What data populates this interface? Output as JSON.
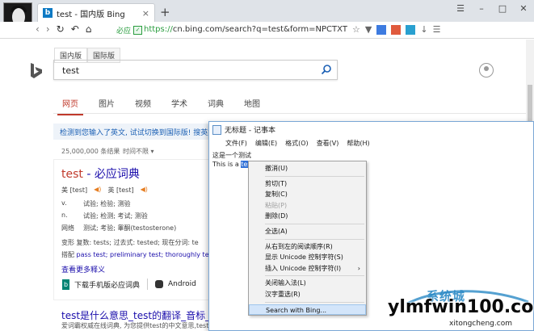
{
  "browser": {
    "tab_title": "test - 国内版 Bing",
    "tab_close": "×",
    "new_tab": "+",
    "window_controls": [
      "☰",
      "–",
      "□",
      "✕"
    ],
    "secure_label": "必应",
    "url_proto": "https://",
    "url_rest": "cn.bing.com/search?q=test&form=NPCTXT",
    "toolbar_icons": [
      "☆",
      "▼",
      "↓",
      "☰"
    ]
  },
  "bing": {
    "region_tabs": [
      "国内版",
      "国际版"
    ],
    "query": "test",
    "scopes": [
      "网页",
      "图片",
      "视频",
      "学术",
      "词典",
      "地图"
    ],
    "notice": "检测到您输入了英文, 试试切换到国际版! 搜英文结果",
    "result_count": "25,000,000 条结果",
    "time_filter": "时间不限 ▾",
    "dict": {
      "title_word": "test",
      "title_rest": " - 必应词典",
      "us_phonetic": "美 [test]",
      "uk_phonetic": "英 [test]",
      "definitions": [
        {
          "pos": "v.",
          "text": "试验; 检验; 测验"
        },
        {
          "pos": "n.",
          "text": "试验; 检测; 考试; 测验"
        },
        {
          "pos": "网络",
          "text": "测试; 考验; 睾酮(testosterone)"
        }
      ],
      "variants": "变形  复数: tests; 过去式: tested; 现在分词: te",
      "phrases_label": "搭配  ",
      "phrases": "pass test; preliminary test; thoroughly test",
      "more": "查看更多释义",
      "app_label": "下载手机版必应词典",
      "android": "Android"
    },
    "result2_title": "test是什么意思_test的翻译_音标_读",
    "result2_snippet": "爱词霸权威在线词典, 为您提供test的中文意思,test的"
  },
  "notepad": {
    "title": "无标题 - 记事本",
    "menu": [
      "文件(F)",
      "编辑(E)",
      "格式(O)",
      "查看(V)",
      "帮助(H)"
    ],
    "line1": "这是一个测试",
    "line2_prefix": "This is a ",
    "line2_selected": "test"
  },
  "context_menu": {
    "items": [
      {
        "label": "撤消(U)",
        "state": "normal"
      },
      {
        "label": "---"
      },
      {
        "label": "剪切(T)",
        "state": "normal"
      },
      {
        "label": "复制(C)",
        "state": "normal"
      },
      {
        "label": "粘贴(P)",
        "state": "disabled"
      },
      {
        "label": "删除(D)",
        "state": "normal"
      },
      {
        "label": "---"
      },
      {
        "label": "全选(A)",
        "state": "normal"
      },
      {
        "label": "---"
      },
      {
        "label": "从右到左的阅读顺序(R)",
        "state": "normal"
      },
      {
        "label": "显示 Unicode 控制字符(S)",
        "state": "normal"
      },
      {
        "label": "插入 Unicode 控制字符(I)",
        "state": "normal",
        "submenu": "›"
      },
      {
        "label": "---"
      },
      {
        "label": "关闭输入法(L)",
        "state": "normal"
      },
      {
        "label": "汉字重选(R)",
        "state": "normal"
      },
      {
        "label": "---"
      },
      {
        "label": "Search with Bing...",
        "state": "hover"
      }
    ]
  },
  "watermark": {
    "cn": "系统城",
    "big": "ylmfwin100.com",
    "small": "xitongcheng.com"
  },
  "colors": {
    "accent_red": "#c0392b",
    "link_blue": "#1a0dab",
    "secure_green": "#2a9d3f",
    "selection": "#2f6fd6"
  }
}
